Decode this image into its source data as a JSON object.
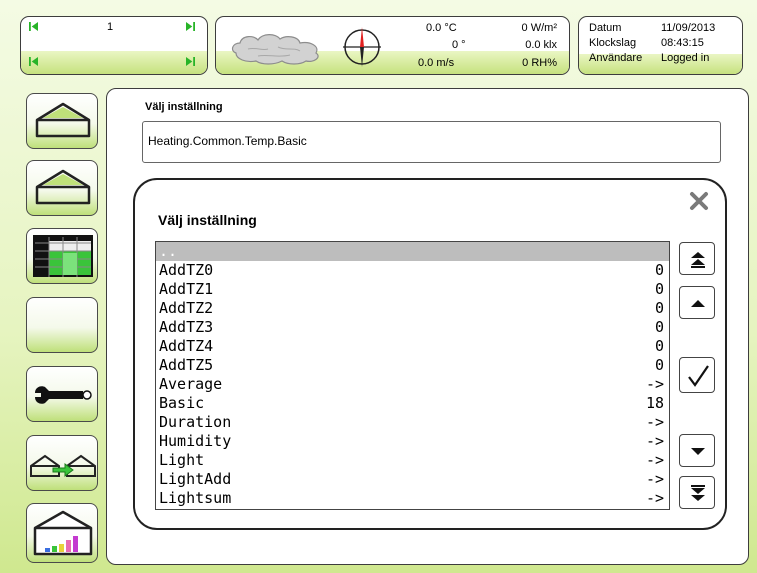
{
  "nav": {
    "value": "1"
  },
  "weather": {
    "temperature": "0.0 °C",
    "wind_direction": "0 °",
    "wind_speed": "0.0 m/s",
    "radiation": "0 W/m²",
    "light": "0.0 klx",
    "humidity": "0 RH%"
  },
  "info": {
    "date_label": "Datum",
    "date_value": "11/09/2013",
    "time_label": "Klockslag",
    "time_value": "08:43:15",
    "user_label": "Användare",
    "user_value": "Logged in"
  },
  "main": {
    "title": "Välj inställning",
    "path": "Heating.Common.Temp.Basic"
  },
  "dialog": {
    "title": "Välj inställning",
    "items": [
      {
        "name": "..",
        "value": ""
      },
      {
        "name": "AddTZ0",
        "value": "0"
      },
      {
        "name": "AddTZ1",
        "value": "0"
      },
      {
        "name": "AddTZ2",
        "value": "0"
      },
      {
        "name": "AddTZ3",
        "value": "0"
      },
      {
        "name": "AddTZ4",
        "value": "0"
      },
      {
        "name": "AddTZ5",
        "value": "0"
      },
      {
        "name": "Average",
        "value": "->"
      },
      {
        "name": "Basic",
        "value": "18"
      },
      {
        "name": "Duration",
        "value": "->"
      },
      {
        "name": "Humidity",
        "value": "->"
      },
      {
        "name": "Light",
        "value": "->"
      },
      {
        "name": "LightAdd",
        "value": "->"
      },
      {
        "name": "Lightsum",
        "value": "->"
      }
    ]
  },
  "icons": {
    "nav_first": "skip-first-icon",
    "nav_last": "skip-last-icon",
    "clouds": "cloud-icon",
    "compass": "compass-icon",
    "close": "close-icon",
    "page_up": "double-up-icon",
    "up": "up-icon",
    "confirm": "check-icon",
    "down": "down-icon",
    "page_down": "double-down-icon"
  },
  "colors": {
    "accent_green": "#c6e27e",
    "nav_green": "#28b428",
    "compass_red": "#e02020",
    "selection": "#bdbdbd"
  }
}
